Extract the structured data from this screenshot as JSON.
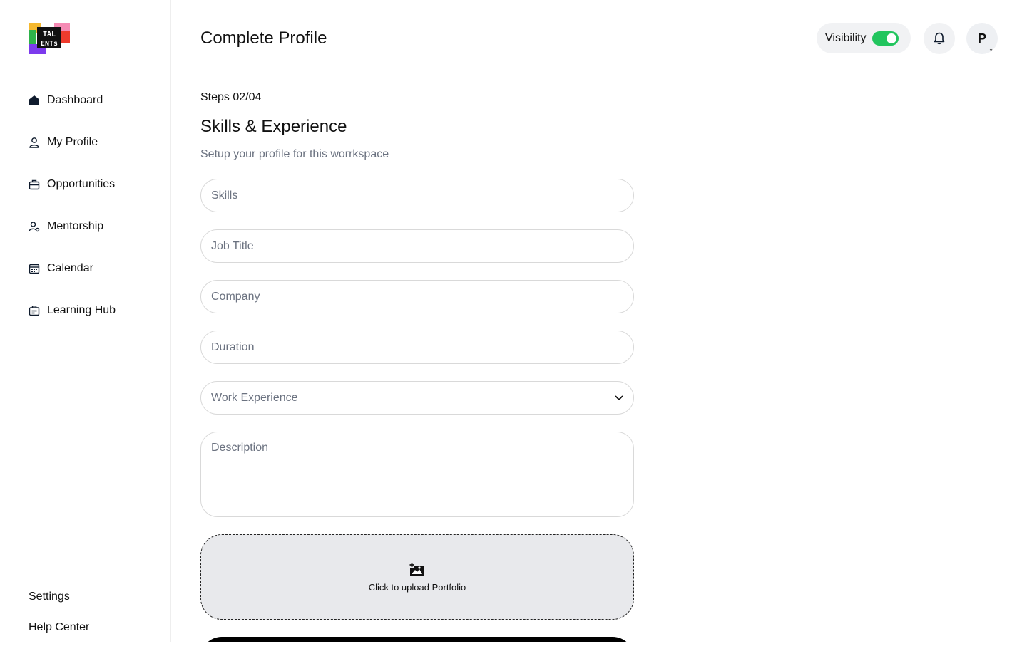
{
  "sidebar": {
    "logo_text": "TALENTS",
    "items": [
      {
        "label": "Dashboard",
        "icon": "home-icon"
      },
      {
        "label": "My Profile",
        "icon": "user-icon"
      },
      {
        "label": "Opportunities",
        "icon": "briefcase-icon"
      },
      {
        "label": "Mentorship",
        "icon": "mentor-icon"
      },
      {
        "label": "Calendar",
        "icon": "calendar-icon"
      },
      {
        "label": "Learning Hub",
        "icon": "learning-icon"
      }
    ],
    "bottom": {
      "settings": "Settings",
      "help": "Help Center"
    }
  },
  "header": {
    "title": "Complete Profile",
    "visibility_label": "Visibility",
    "visibility_on": true,
    "avatar_initial": "P"
  },
  "form": {
    "steps": "Steps 02/04",
    "title": "Skills & Experience",
    "subtitle": "Setup your profile for this worrkspace",
    "fields": {
      "skills": {
        "placeholder": "Skills",
        "value": ""
      },
      "job_title": {
        "placeholder": "Job Title",
        "value": ""
      },
      "company": {
        "placeholder": "Company",
        "value": ""
      },
      "duration": {
        "placeholder": "Duration",
        "value": ""
      },
      "work_experience": {
        "selected": "Work Experience"
      },
      "description": {
        "placeholder": "Description",
        "value": ""
      }
    },
    "upload_label": "Click to upload Portfolio"
  },
  "colors": {
    "accent_toggle": "#22c55e",
    "muted_text": "#6b7280",
    "border": "#d9d9d9",
    "upload_bg": "#e8e9ec"
  }
}
